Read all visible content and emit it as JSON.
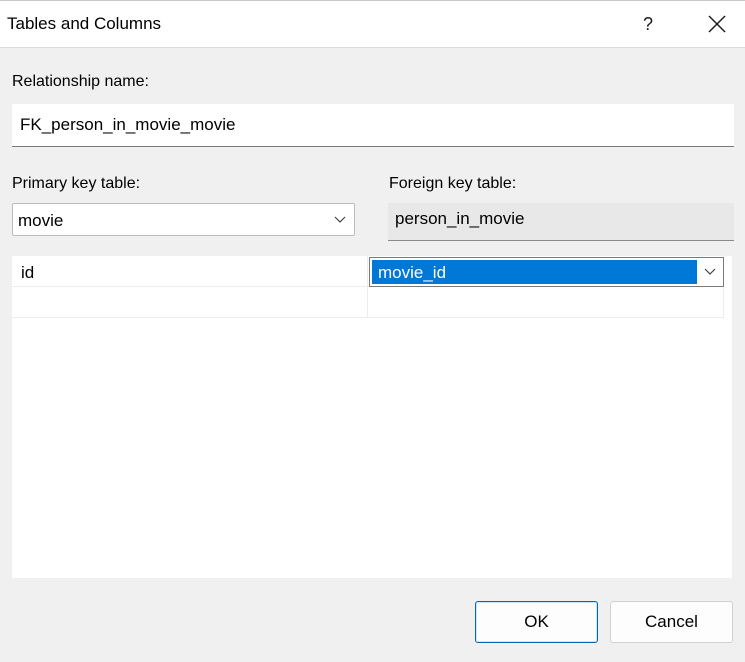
{
  "dialog": {
    "title": "Tables and Columns",
    "help_glyph": "?",
    "icons": {
      "close": "close-icon",
      "help": "help-icon",
      "dropdown": "chevron-down-icon"
    }
  },
  "relationship": {
    "label": "Relationship name:",
    "value": "FK_person_in_movie_movie"
  },
  "primary_key": {
    "label": "Primary key table:",
    "selected": "movie"
  },
  "foreign_key": {
    "label": "Foreign key table:",
    "value": "person_in_movie"
  },
  "columns": {
    "rows": [
      {
        "primary": "id",
        "foreign": "movie_id"
      },
      {
        "primary": "",
        "foreign": ""
      }
    ]
  },
  "buttons": {
    "ok": "OK",
    "cancel": "Cancel"
  },
  "colors": {
    "selection": "#0078d7",
    "primary_button_border": "#0067c0"
  }
}
